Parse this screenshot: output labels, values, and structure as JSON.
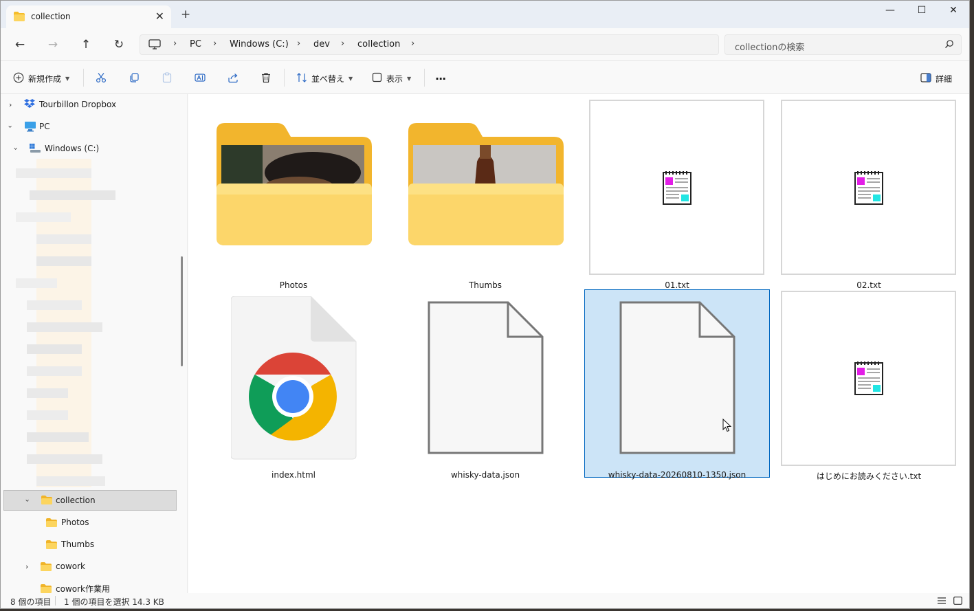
{
  "window": {
    "tab_title": "collection",
    "new_tab": "+",
    "close_tab": "✕",
    "minimize": "—",
    "maximize": "☐",
    "close": "✕"
  },
  "nav": {
    "back": "←",
    "forward": "→",
    "up": "↑",
    "refresh": "↻"
  },
  "address": {
    "crumbs": [
      "PC",
      "Windows (C:)",
      "dev",
      "collection"
    ],
    "separator": "›"
  },
  "search": {
    "placeholder": "collectionの検索"
  },
  "toolbar": {
    "new_label": "新規作成",
    "sort_label": "並べ替え",
    "view_label": "表示",
    "more_label": "···",
    "details_label": "詳細"
  },
  "sidebar": {
    "items": [
      {
        "label": "Tourbillon Dropbox"
      },
      {
        "label": "PC"
      },
      {
        "label": "Windows (C:)"
      },
      {
        "label": "collection"
      },
      {
        "label": "Photos"
      },
      {
        "label": "Thumbs"
      },
      {
        "label": "cowork"
      },
      {
        "label": "cowork作業用"
      }
    ]
  },
  "files": [
    {
      "name": "Photos",
      "type": "folder"
    },
    {
      "name": "Thumbs",
      "type": "folder"
    },
    {
      "name": "01.txt",
      "type": "txt"
    },
    {
      "name": "02.txt",
      "type": "txt"
    },
    {
      "name": "index.html",
      "type": "html"
    },
    {
      "name": "whisky-data.json",
      "type": "json"
    },
    {
      "name": "whisky-data-20260810-1350.json",
      "type": "json",
      "selected": true
    },
    {
      "name": "はじめにお読みください.txt",
      "type": "txt"
    }
  ],
  "status": {
    "item_count": "8 個の項目",
    "selection": "1 個の項目を選択  14.3 KB"
  },
  "colors": {
    "accent": "#0067c0",
    "selection_bg": "#cce4f7",
    "folder": "#f5bd2a"
  }
}
